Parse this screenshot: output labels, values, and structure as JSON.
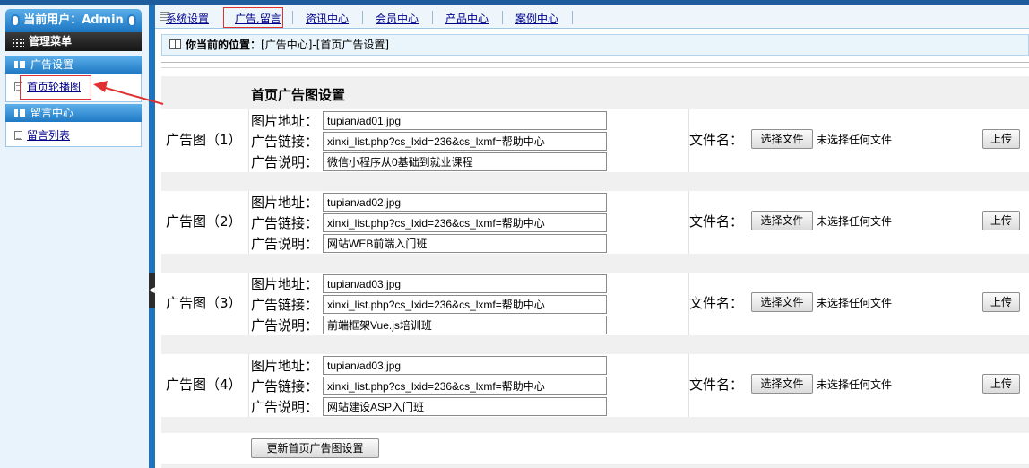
{
  "sidebar": {
    "current_user": "当前用户：Admin",
    "menu_title": "管理菜单",
    "sections": [
      {
        "title": "广告设置",
        "items": [
          "首页轮播图"
        ]
      },
      {
        "title": "留言中心",
        "items": [
          "留言列表"
        ]
      }
    ]
  },
  "topnav": {
    "items": [
      "系统设置",
      "广告,留言",
      "资讯中心",
      "会员中心",
      "产品中心",
      "案例中心"
    ]
  },
  "breadcrumb": {
    "label": "你当前的位置：",
    "path": "[广告中心]-[首页广告设置]"
  },
  "form": {
    "title": "首页广告图设置",
    "field_labels": {
      "image": "图片地址：",
      "link": "广告链接：",
      "desc": "广告说明："
    },
    "file_label": "文件名：",
    "choose_label": "选择文件",
    "no_file_text": "未选择任何文件",
    "upload_label": "上传",
    "submit_label": "更新首页广告图设置",
    "ads": [
      {
        "label": "广告图（1）",
        "image": "tupian/ad01.jpg",
        "link": "xinxi_list.php?cs_lxid=236&cs_lxmf=帮助中心",
        "desc": "微信小程序从0基础到就业课程"
      },
      {
        "label": "广告图（2）",
        "image": "tupian/ad02.jpg",
        "link": "xinxi_list.php?cs_lxid=236&cs_lxmf=帮助中心",
        "desc": "网站WEB前端入门班"
      },
      {
        "label": "广告图（3）",
        "image": "tupian/ad03.jpg",
        "link": "xinxi_list.php?cs_lxid=236&cs_lxmf=帮助中心",
        "desc": "前端框架Vue.js培训班"
      },
      {
        "label": "广告图（4）",
        "image": "tupian/ad03.jpg",
        "link": "xinxi_list.php?cs_lxid=236&cs_lxmf=帮助中心",
        "desc": "网站建设ASP入门班"
      }
    ]
  },
  "colors": {
    "accent": "#1f79c4",
    "link": "#00008b",
    "annotation": "#e03030"
  }
}
